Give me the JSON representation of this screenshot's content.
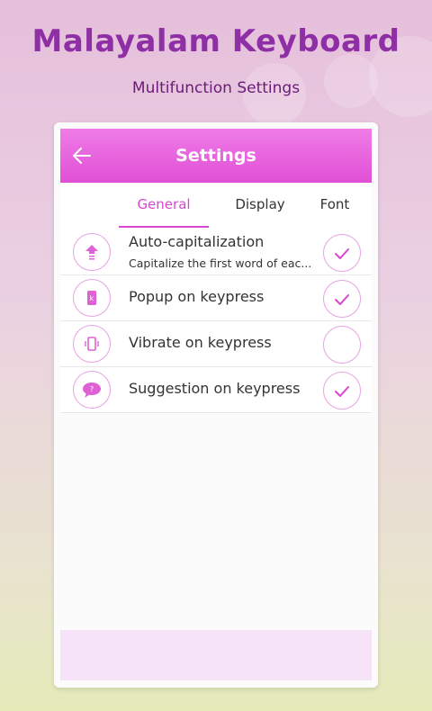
{
  "promo": {
    "title": "Malayalam Keyboard",
    "subtitle": "Multifunction Settings"
  },
  "app_bar": {
    "title": "Settings",
    "back_icon": "arrow-left-icon",
    "color": "#e04fd6"
  },
  "tabs": [
    {
      "label": "General",
      "active": true
    },
    {
      "label": "Display",
      "active": false
    },
    {
      "label": "Font",
      "active": false
    }
  ],
  "settings": [
    {
      "icon": "upload-arrow-icon",
      "label": "Auto-capitalization",
      "sub": "Capitalize the first word of eac...",
      "checked": true
    },
    {
      "icon": "key-popup-icon",
      "label": "Popup on keypress",
      "checked": true
    },
    {
      "icon": "phone-vibrate-icon",
      "label": "Vibrate on keypress",
      "checked": false
    },
    {
      "icon": "chat-question-icon",
      "label": "Suggestion on keypress",
      "checked": true
    }
  ],
  "colors": {
    "accent": "#d946cf",
    "icon_fill": "#e060d6"
  }
}
